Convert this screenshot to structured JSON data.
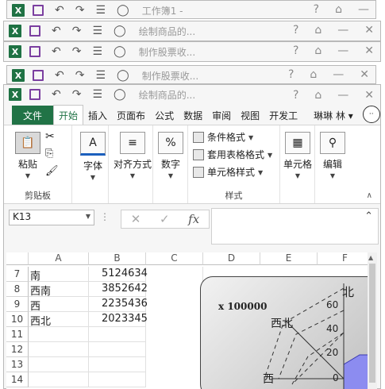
{
  "bg_windows": [
    {
      "title": "工作簿1 -"
    },
    {
      "title": "绘制商品的..."
    },
    {
      "title": "制作股票收..."
    },
    {
      "title": "制作股票收..."
    }
  ],
  "window": {
    "title": "绘制商品的..."
  },
  "win_controls": {
    "help": "?",
    "restore": "⌂",
    "minimize": "—",
    "close": "✕"
  },
  "ribbon_tabs": [
    "文件",
    "开始",
    "插入",
    "页面布",
    "公式",
    "数据",
    "审阅",
    "视图",
    "开发工"
  ],
  "user": {
    "name": "琳琳 林 ▾"
  },
  "ribbon": {
    "clipboard": {
      "paste": "粘贴",
      "group": "剪贴板"
    },
    "font": "字体",
    "alignment": "对齐方式",
    "number": "数字",
    "styles": {
      "conditional": "条件格式",
      "table": "套用表格格式",
      "cell_styles": "单元格样式",
      "group": "样式"
    },
    "cells": "单元格",
    "editing": "编辑"
  },
  "formula_bar": {
    "name_box": "K13",
    "cancel": "✕",
    "enter": "✓",
    "fx": "fx",
    "value": ""
  },
  "sheet": {
    "columns": [
      "A",
      "B",
      "C",
      "D",
      "E",
      "F"
    ],
    "rows": [
      {
        "num": "7",
        "a": "南",
        "b": "5124634"
      },
      {
        "num": "8",
        "a": "西南",
        "b": "3852642"
      },
      {
        "num": "9",
        "a": "西",
        "b": "2235436"
      },
      {
        "num": "10",
        "a": "西北",
        "b": "2023345"
      },
      {
        "num": "11",
        "a": "",
        "b": ""
      },
      {
        "num": "12",
        "a": "",
        "b": ""
      },
      {
        "num": "13",
        "a": "",
        "b": ""
      },
      {
        "num": "14",
        "a": "",
        "b": ""
      }
    ]
  },
  "chart": {
    "unit_label": "x 100000",
    "axis_ticks": [
      "60",
      "40",
      "20",
      "0"
    ],
    "category_labels": [
      "北",
      "西北",
      "西"
    ],
    "fill_color": "#8c8cf0"
  }
}
